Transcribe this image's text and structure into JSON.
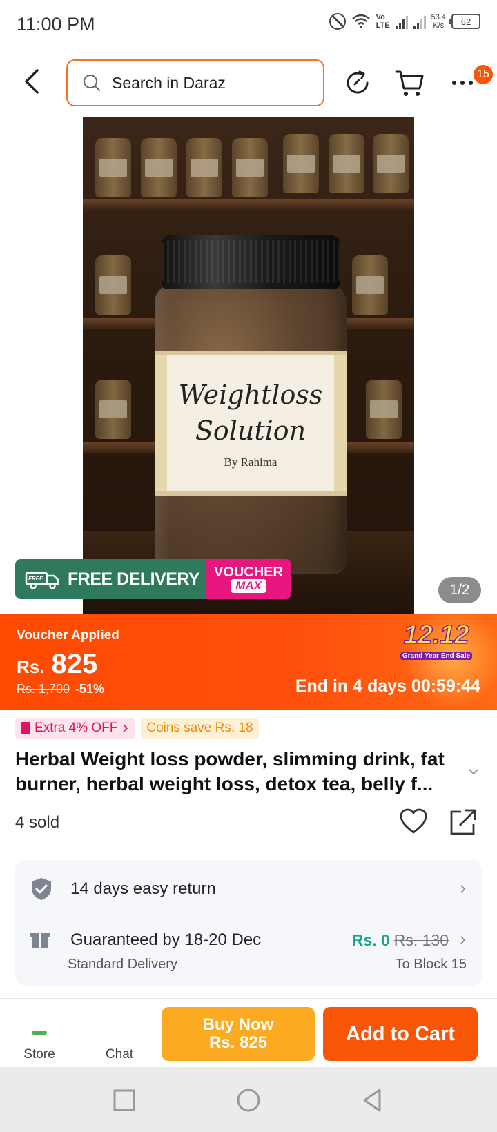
{
  "status_bar": {
    "time": "11:00 PM",
    "volte_top": "Vo",
    "volte_bottom": "LTE",
    "net_speed_value": "53.4",
    "net_speed_unit": "K/s",
    "battery": "62"
  },
  "header": {
    "search_placeholder": "Search in Daraz",
    "menu_badge": "15"
  },
  "gallery": {
    "product_label_line1": "Weightloss",
    "product_label_line2": "Solution",
    "product_label_by": "By Rahima",
    "free_badge": "FREE",
    "delivery_banner": "FREE DELIVERY",
    "voucher_top": "VOUCHER",
    "voucher_bottom": "MAX",
    "page_indicator": "1/2"
  },
  "price_bar": {
    "voucher_applied": "Voucher Applied",
    "currency": "Rs.",
    "price": "825",
    "original_price": "Rs. 1,700",
    "discount": "-51%",
    "sale_logo": "12.12",
    "sale_subtitle": "Grand Year End Sale",
    "countdown": "End in 4 days 00:59:44"
  },
  "promos": {
    "extra_off": "Extra 4% OFF",
    "coins": "Coins save Rs. 18"
  },
  "product": {
    "title": "Herbal Weight loss powder, slimming drink, fat burner, herbal weight loss, detox tea, belly f...",
    "sold": "4 sold"
  },
  "services": {
    "return_text": "14 days easy return",
    "guarantee_text": "Guaranteed by 18-20 Dec",
    "shipping_price": "Rs. 0",
    "shipping_old_price": "Rs. 130",
    "delivery_type": "Standard Delivery",
    "destination": "To Block 15"
  },
  "action_bar": {
    "store_label": "Store",
    "chat_label": "Chat",
    "buy_now_line1": "Buy Now",
    "buy_now_line2": "Rs. 825",
    "add_to_cart": "Add to Cart"
  },
  "colors": {
    "brand_orange": "#f85606",
    "buy_now": "#fbaa21",
    "free_shipping": "#1aa38f"
  }
}
